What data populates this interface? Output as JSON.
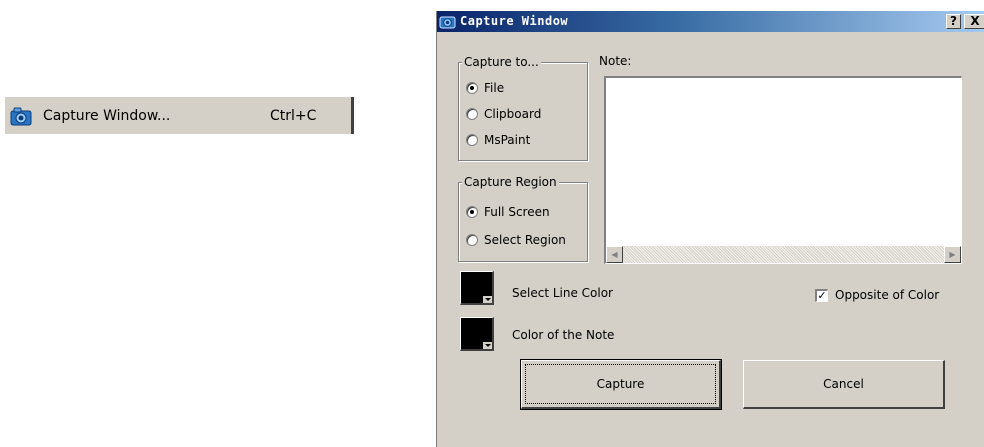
{
  "menu": {
    "icon": "camera-icon",
    "label": "Capture Window...",
    "shortcut": "Ctrl+C"
  },
  "dialog": {
    "title": "Capture Window",
    "title_icon": "camera-icon",
    "help_label": "?",
    "close_label": "X",
    "capture_to": {
      "legend": "Capture to...",
      "options": [
        {
          "label": "File",
          "selected": true
        },
        {
          "label": "Clipboard",
          "selected": false
        },
        {
          "label": "MsPaint",
          "selected": false
        }
      ]
    },
    "capture_region": {
      "legend": "Capture Region",
      "options": [
        {
          "label": "Full Screen",
          "selected": true
        },
        {
          "label": "Select Region",
          "selected": false
        }
      ]
    },
    "note": {
      "label": "Note:",
      "value": ""
    },
    "line_color": {
      "label": "Select Line Color",
      "color": "#000000"
    },
    "note_color": {
      "label": "Color of the Note",
      "color": "#000000"
    },
    "opposite_color": {
      "label": "Opposite of Color",
      "checked": true
    },
    "capture_button": "Capture",
    "cancel_button": "Cancel"
  },
  "colors": {
    "face": "#d4d0c8",
    "title_start": "#0a246a",
    "title_end": "#a6caf0"
  }
}
